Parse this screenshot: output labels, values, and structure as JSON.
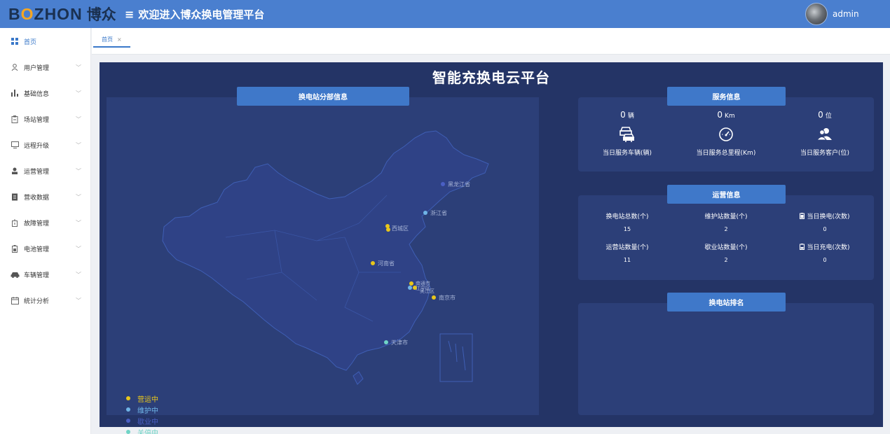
{
  "header": {
    "logo_latin": "BOZHON",
    "logo_cn": "博众",
    "title": "欢迎进入博众换电管理平台",
    "username": "admin"
  },
  "sidebar": {
    "items": [
      {
        "label": "首页",
        "icon": "grid-icon",
        "active": true
      },
      {
        "label": "用户管理",
        "icon": "user-icon"
      },
      {
        "label": "基础信息",
        "icon": "bar-chart-icon"
      },
      {
        "label": "场站管理",
        "icon": "clipboard-icon"
      },
      {
        "label": "远程升级",
        "icon": "monitor-icon"
      },
      {
        "label": "运营管理",
        "icon": "operator-icon"
      },
      {
        "label": "营收数据",
        "icon": "document-icon"
      },
      {
        "label": "故障管理",
        "icon": "fault-icon"
      },
      {
        "label": "电池管理",
        "icon": "battery-icon"
      },
      {
        "label": "车辆管理",
        "icon": "car-icon"
      },
      {
        "label": "统计分析",
        "icon": "calendar-icon"
      }
    ]
  },
  "tabs": [
    {
      "label": "首页",
      "close": "×"
    }
  ],
  "dashboard": {
    "title": "智能充换电云平台",
    "map": {
      "title": "换电站分部信息",
      "labels": [
        {
          "name": "黑龙江省",
          "status": "maintenance"
        },
        {
          "name": "浙江省",
          "status": "maintenance"
        },
        {
          "name": "西城区",
          "status": "operating"
        },
        {
          "name": "河南省",
          "status": "operating"
        },
        {
          "name": "南通市",
          "status": "operating"
        },
        {
          "name": "江宁区",
          "status": "operating"
        },
        {
          "name": "吴江区",
          "status": "operating"
        },
        {
          "name": "南京市",
          "status": "operating"
        },
        {
          "name": "天津市",
          "status": "closed"
        }
      ],
      "legend": [
        {
          "label": "营运中",
          "color": "#e8c61b"
        },
        {
          "label": "维护中",
          "color": "#6fb4e6"
        },
        {
          "label": "歇业中",
          "color": "#4a5fc4"
        },
        {
          "label": "关停中",
          "color": "#6fd4c6"
        }
      ]
    },
    "service": {
      "title": "服务信息",
      "items": [
        {
          "value": "0",
          "unit": "辆",
          "label": "当日服务车辆(辆)",
          "icon": "vehicle-icon"
        },
        {
          "value": "0",
          "unit": "Km",
          "label": "当日服务总里程(Km)",
          "icon": "speedometer-icon"
        },
        {
          "value": "0",
          "unit": "位",
          "label": "当日服务客户(位)",
          "icon": "users-icon"
        }
      ]
    },
    "operations": {
      "title": "运营信息",
      "items": [
        {
          "label": "换电站总数(个)",
          "value": "15"
        },
        {
          "label": "维护站数量(个)",
          "value": "2"
        },
        {
          "label": "当日换电(次数)",
          "value": "0",
          "icon": "battery-swap-icon"
        },
        {
          "label": "运营站数量(个)",
          "value": "11"
        },
        {
          "label": "歇业站数量(个)",
          "value": "2"
        },
        {
          "label": "当日充电(次数)",
          "value": "0",
          "icon": "charge-icon"
        }
      ]
    },
    "ranking": {
      "title": "换电站排名"
    }
  }
}
